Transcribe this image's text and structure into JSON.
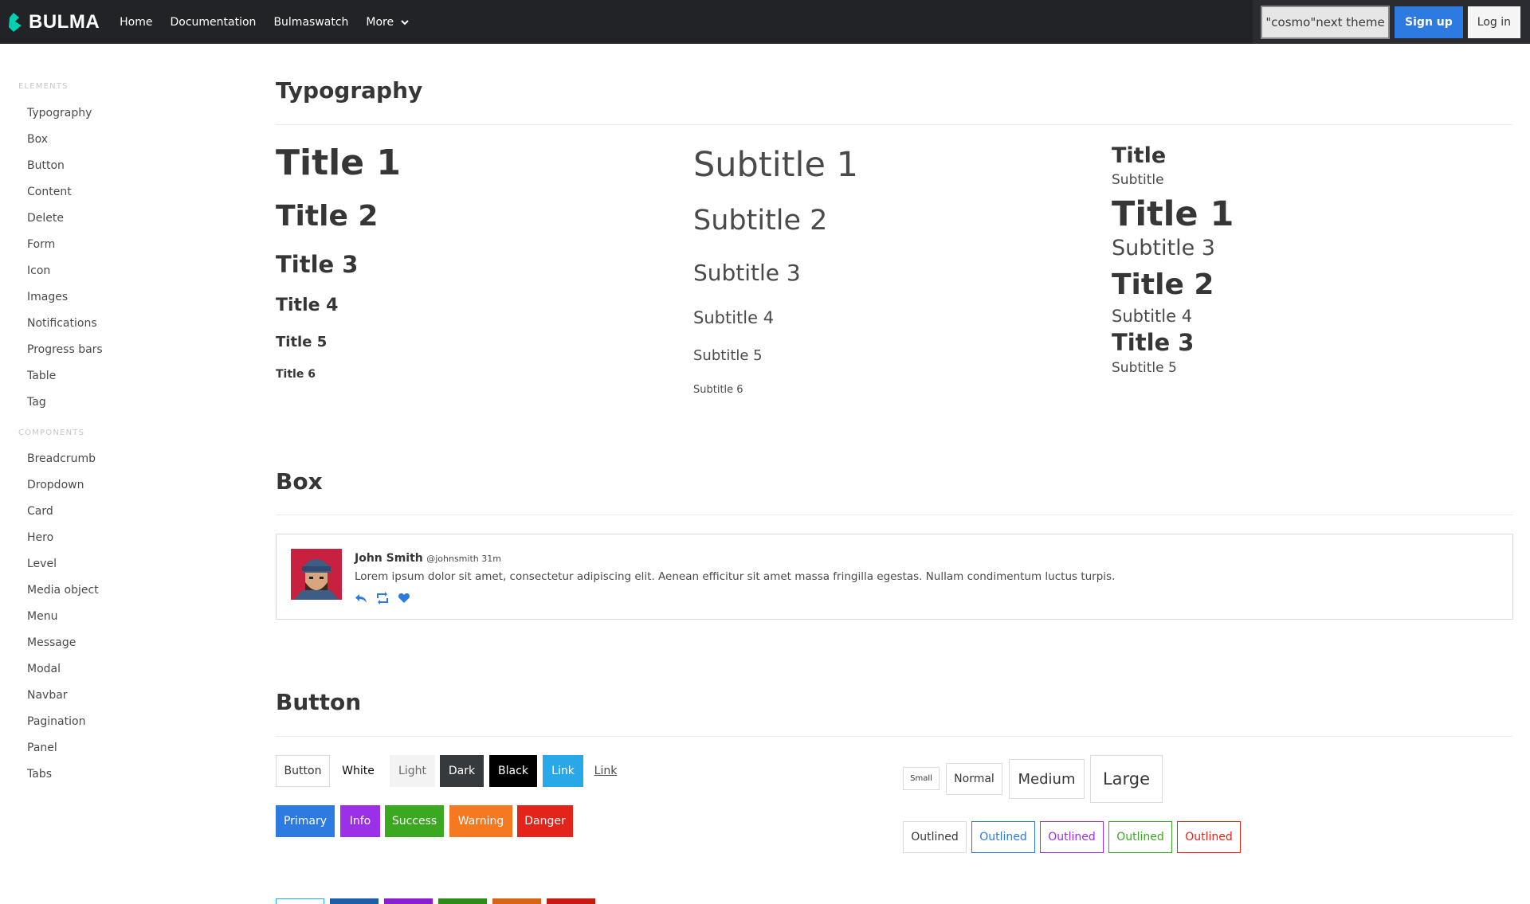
{
  "navbar": {
    "brand": "BULMA",
    "items": [
      "Home",
      "Documentation",
      "Bulmaswatch",
      "More"
    ],
    "theme_button": "\"cosmo\"next theme",
    "signup": "Sign up",
    "login": "Log in"
  },
  "sidebar": {
    "elements_label": "ELEMENTS",
    "elements": [
      "Typography",
      "Box",
      "Button",
      "Content",
      "Delete",
      "Form",
      "Icon",
      "Images",
      "Notifications",
      "Progress bars",
      "Table",
      "Tag"
    ],
    "components_label": "COMPONENTS",
    "components": [
      "Breadcrumb",
      "Dropdown",
      "Card",
      "Hero",
      "Level",
      "Media object",
      "Menu",
      "Message",
      "Modal",
      "Navbar",
      "Pagination",
      "Panel",
      "Tabs"
    ]
  },
  "typography": {
    "heading": "Typography",
    "titles": [
      "Title 1",
      "Title 2",
      "Title 3",
      "Title 4",
      "Title 5",
      "Title 6"
    ],
    "subtitles": [
      "Subtitle 1",
      "Subtitle 2",
      "Subtitle 3",
      "Subtitle 4",
      "Subtitle 5",
      "Subtitle 6"
    ],
    "pairs": [
      "Title",
      "Subtitle",
      "Title 1",
      "Subtitle 3",
      "Title 2",
      "Subtitle 4",
      "Title 3",
      "Subtitle 5"
    ]
  },
  "box": {
    "heading": "Box",
    "name": "John Smith",
    "handle": "@johnsmith 31m",
    "text": "Lorem ipsum dolor sit amet, consectetur adipiscing elit. Aenean efficitur sit amet massa fringilla egestas. Nullam condimentum luctus turpis."
  },
  "buttons": {
    "heading": "Button",
    "row1": [
      "Button",
      "White",
      "Light",
      "Dark",
      "Black",
      "Link",
      "Link"
    ],
    "row2": [
      "Primary",
      "Info",
      "Success",
      "Warning",
      "Danger"
    ],
    "sizes": [
      "Small",
      "Normal",
      "Medium",
      "Large"
    ],
    "outlined": [
      "Outlined",
      "Outlined",
      "Outlined",
      "Outlined",
      "Outlined"
    ]
  },
  "colors": {
    "primary": "#2d7ae0",
    "info": "#9b30e8",
    "success": "#3aa820",
    "warning": "#f47920",
    "danger": "#e3241b",
    "link": "#28a8e8",
    "dark": "#373a3c",
    "black": "#000000"
  }
}
